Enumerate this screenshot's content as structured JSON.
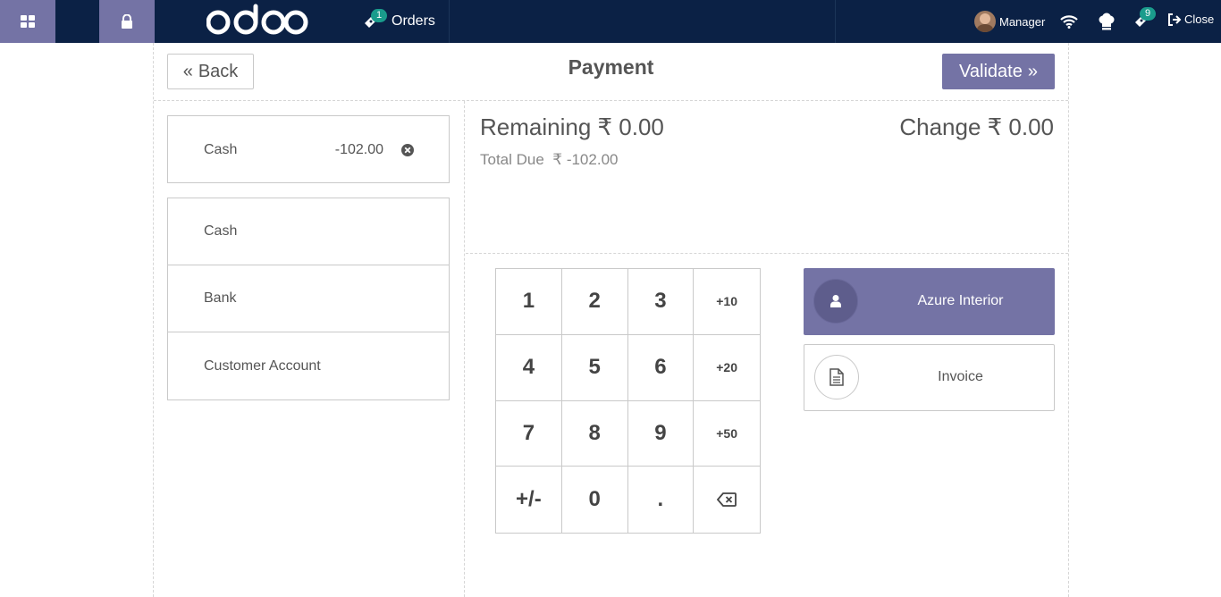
{
  "topbar": {
    "orders_label": "Orders",
    "orders_count": "1",
    "user_name": "Manager",
    "tickets_count": "9",
    "close_label": "Close",
    "brand": "odoo",
    "icons": [
      "apps-grid-icon",
      "lock-icon",
      "ticket-icon",
      "wifi-icon",
      "chef-hat-icon",
      "ticket-icon",
      "sign-out-icon"
    ]
  },
  "header": {
    "back_label": "Back",
    "title": "Payment",
    "validate_label": "Validate"
  },
  "payment_lines": [
    {
      "method": "Cash",
      "amount": "-102.00"
    }
  ],
  "payment_methods": [
    "Cash",
    "Bank",
    "Customer Account"
  ],
  "summary": {
    "remaining": "Remaining ₹ 0.00",
    "change": "Change ₹ 0.00",
    "total_due_label": "Total Due",
    "total_due_value": "₹ -102.00"
  },
  "numpad": [
    "1",
    "2",
    "3",
    "+10",
    "4",
    "5",
    "6",
    "+20",
    "7",
    "8",
    "9",
    "+50",
    "+/-",
    "0",
    ".",
    "⌫"
  ],
  "customer": {
    "name": "Azure Interior"
  },
  "invoice": {
    "label": "Invoice"
  },
  "colors": {
    "accent": "#7473a5",
    "topbar": "#0b2145",
    "badge": "#1a9c8c"
  }
}
